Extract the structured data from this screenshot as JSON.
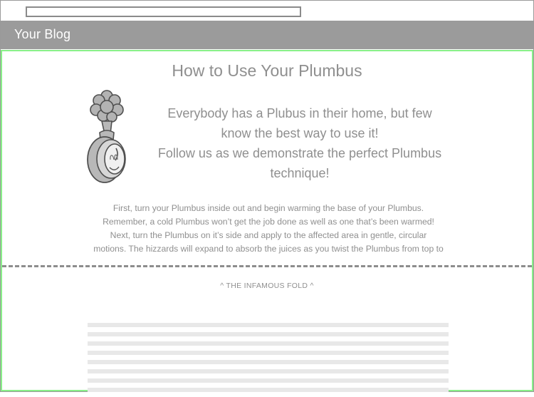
{
  "blog": {
    "name": "Your Blog"
  },
  "post": {
    "title": "How to Use Your Plumbus",
    "intro": [
      "Everybody has a Plubus in their home, but few know the best way to use it!",
      "Follow us as we demonstrate the perfect Plumbus technique!"
    ],
    "body": [
      "First, turn your Plumbus inside out and begin warming the base of your Plumbus.",
      "Remember, a cold Plumbus won’t get the job done as well as one that’s been warmed!",
      "Next, turn the Plumbus on it’s side and apply to the affected area in gentle, circular",
      "motions. The hizzards will expand to absorb the juices as you twist the Plumbus from top to"
    ],
    "illustration_icon": "plumbus-illustration"
  },
  "fold": {
    "label": "^ THE INFAMOUS FOLD ^"
  },
  "colors": {
    "header_bg": "#9b9b9b",
    "content_border": "#88ef88",
    "text": "#8f8f8f",
    "placeholder": "#e8e8e8"
  }
}
